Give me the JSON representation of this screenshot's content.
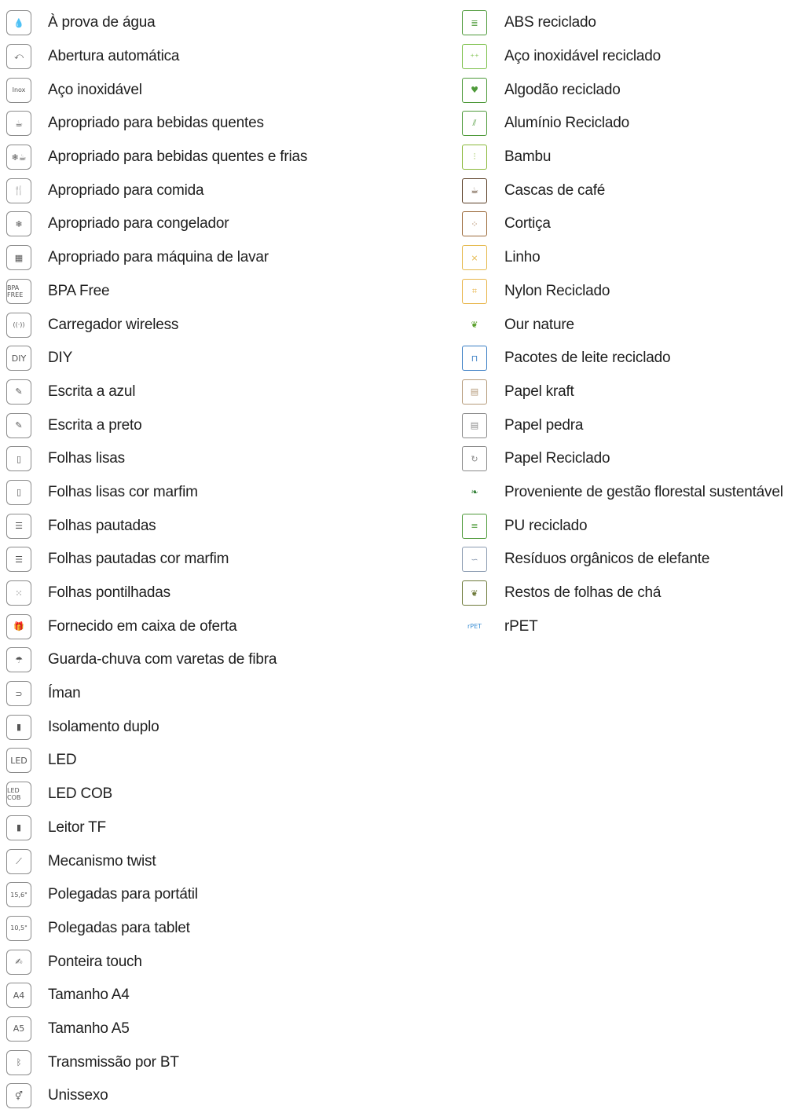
{
  "left_column": [
    {
      "label": "À prova de água",
      "icon": "water-drop-icon",
      "glyph": "💧"
    },
    {
      "label": "Abertura automática",
      "icon": "auto-open-icon",
      "glyph": "⤺"
    },
    {
      "label": "Aço inoxidável",
      "icon": "inox-icon",
      "glyph": "Inox"
    },
    {
      "label": "Apropriado para bebidas quentes",
      "icon": "hot-drink-cup-icon",
      "glyph": "☕"
    },
    {
      "label": "Apropriado para bebidas quentes e frias",
      "icon": "hot-cold-drink-icon",
      "glyph": "❄☕"
    },
    {
      "label": "Apropriado para comida",
      "icon": "food-container-icon",
      "glyph": "🍴"
    },
    {
      "label": "Apropriado para congelador",
      "icon": "freezer-icon",
      "glyph": "❄"
    },
    {
      "label": "Apropriado para máquina de lavar",
      "icon": "dishwasher-icon",
      "glyph": "▦"
    },
    {
      "label": "BPA Free",
      "icon": "bpa-free-icon",
      "glyph": "BPA FREE"
    },
    {
      "label": "Carregador wireless",
      "icon": "wireless-charger-icon",
      "glyph": "((·))"
    },
    {
      "label": "DIY",
      "icon": "diy-icon",
      "glyph": "DIY"
    },
    {
      "label": "Escrita a azul",
      "icon": "pen-blue-icon",
      "glyph": "✎"
    },
    {
      "label": "Escrita a preto",
      "icon": "pen-black-icon",
      "glyph": "✎"
    },
    {
      "label": "Folhas lisas",
      "icon": "plain-sheet-icon",
      "glyph": "▯"
    },
    {
      "label": "Folhas lisas cor marfim",
      "icon": "ivory-plain-sheet-icon",
      "glyph": "▯"
    },
    {
      "label": "Folhas pautadas",
      "icon": "lined-sheet-icon",
      "glyph": "☰"
    },
    {
      "label": "Folhas pautadas cor marfim",
      "icon": "ivory-lined-sheet-icon",
      "glyph": "☰"
    },
    {
      "label": "Folhas pontilhadas",
      "icon": "dotted-sheet-icon",
      "glyph": "⁙"
    },
    {
      "label": "Fornecido em caixa de oferta",
      "icon": "gift-box-icon",
      "glyph": "🎁"
    },
    {
      "label": "Guarda-chuva com varetas de fibra",
      "icon": "umbrella-fiber-icon",
      "glyph": "☂"
    },
    {
      "label": "Íman",
      "icon": "magnet-icon",
      "glyph": "⊃"
    },
    {
      "label": "Isolamento duplo",
      "icon": "double-insulation-icon",
      "glyph": "▮"
    },
    {
      "label": "LED",
      "icon": "led-icon",
      "glyph": "LED"
    },
    {
      "label": "LED COB",
      "icon": "led-cob-icon",
      "glyph": "LED COB"
    },
    {
      "label": "Leitor TF",
      "icon": "tf-card-icon",
      "glyph": "▮"
    },
    {
      "label": "Mecanismo twist",
      "icon": "twist-pen-icon",
      "glyph": "⟋"
    },
    {
      "label": "Polegadas para portátil",
      "icon": "laptop-inches-icon",
      "glyph": "15,6\""
    },
    {
      "label": "Polegadas para tablet",
      "icon": "tablet-inches-icon",
      "glyph": "10,5\""
    },
    {
      "label": "Ponteira touch",
      "icon": "touch-stylus-icon",
      "glyph": "✍"
    },
    {
      "label": "Tamanho A4",
      "icon": "a4-size-icon",
      "glyph": "A4"
    },
    {
      "label": "Tamanho A5",
      "icon": "a5-size-icon",
      "glyph": "A5"
    },
    {
      "label": "Transmissão por BT",
      "icon": "bluetooth-icon",
      "glyph": "ᛒ"
    },
    {
      "label": "Unissexo",
      "icon": "unisex-icon",
      "glyph": "⚥"
    }
  ],
  "right_column": [
    {
      "label": "ABS reciclado",
      "icon": "recycled-abs-icon",
      "glyph": "≣",
      "color": "#4e9a3a"
    },
    {
      "label": "Aço inoxidável reciclado",
      "icon": "recycled-steel-icon",
      "glyph": "⁺⁺",
      "color": "#7cc04a"
    },
    {
      "label": "Algodão reciclado",
      "icon": "recycled-cotton-icon",
      "glyph": "♥",
      "color": "#4e9a3a"
    },
    {
      "label": "Alumínio Reciclado",
      "icon": "recycled-aluminium-icon",
      "glyph": "⫽",
      "color": "#4e9a3a"
    },
    {
      "label": "Bambu",
      "icon": "bamboo-icon",
      "glyph": "⫶",
      "color": "#8ab83a"
    },
    {
      "label": "Cascas de café",
      "icon": "coffee-husk-icon",
      "glyph": "☕",
      "color": "#5a3d24"
    },
    {
      "label": "Cortiça",
      "icon": "cork-icon",
      "glyph": "⁘",
      "color": "#9c6b3c"
    },
    {
      "label": "Linho",
      "icon": "linen-icon",
      "glyph": "⨯",
      "color": "#e5b84a"
    },
    {
      "label": "Nylon Reciclado",
      "icon": "recycled-nylon-icon",
      "glyph": "⌗",
      "color": "#e8b448"
    },
    {
      "label": "Our nature",
      "icon": "our-nature-icon",
      "glyph": "❦",
      "color": "#5aa02c"
    },
    {
      "label": "Pacotes de leite reciclado",
      "icon": "recycled-milk-carton-icon",
      "glyph": "⊓",
      "color": "#3a7ec4"
    },
    {
      "label": "Papel kraft",
      "icon": "kraft-paper-icon",
      "glyph": "▤",
      "color": "#b59a7a"
    },
    {
      "label": "Papel pedra",
      "icon": "stone-paper-icon",
      "glyph": "▤",
      "color": "#8a8a8a"
    },
    {
      "label": "Papel Reciclado",
      "icon": "recycled-paper-icon",
      "glyph": "↻",
      "color": "#8a8a8a"
    },
    {
      "label": "Proveniente de gestão florestal sustentável",
      "icon": "sustainable-forest-icon",
      "glyph": "❧",
      "color": "#2e7d32"
    },
    {
      "label": "PU reciclado",
      "icon": "recycled-pu-icon",
      "glyph": "≡",
      "color": "#4e9a3a"
    },
    {
      "label": "Resíduos orgânicos de elefante",
      "icon": "elephant-dung-icon",
      "glyph": "∽",
      "color": "#8a9ab0"
    },
    {
      "label": "Restos de folhas de chá",
      "icon": "tea-leaves-icon",
      "glyph": "❦",
      "color": "#6e7a3a"
    },
    {
      "label": "rPET",
      "icon": "rpet-bottle-icon",
      "glyph": "rPET",
      "color": "#3a8ed4"
    }
  ]
}
